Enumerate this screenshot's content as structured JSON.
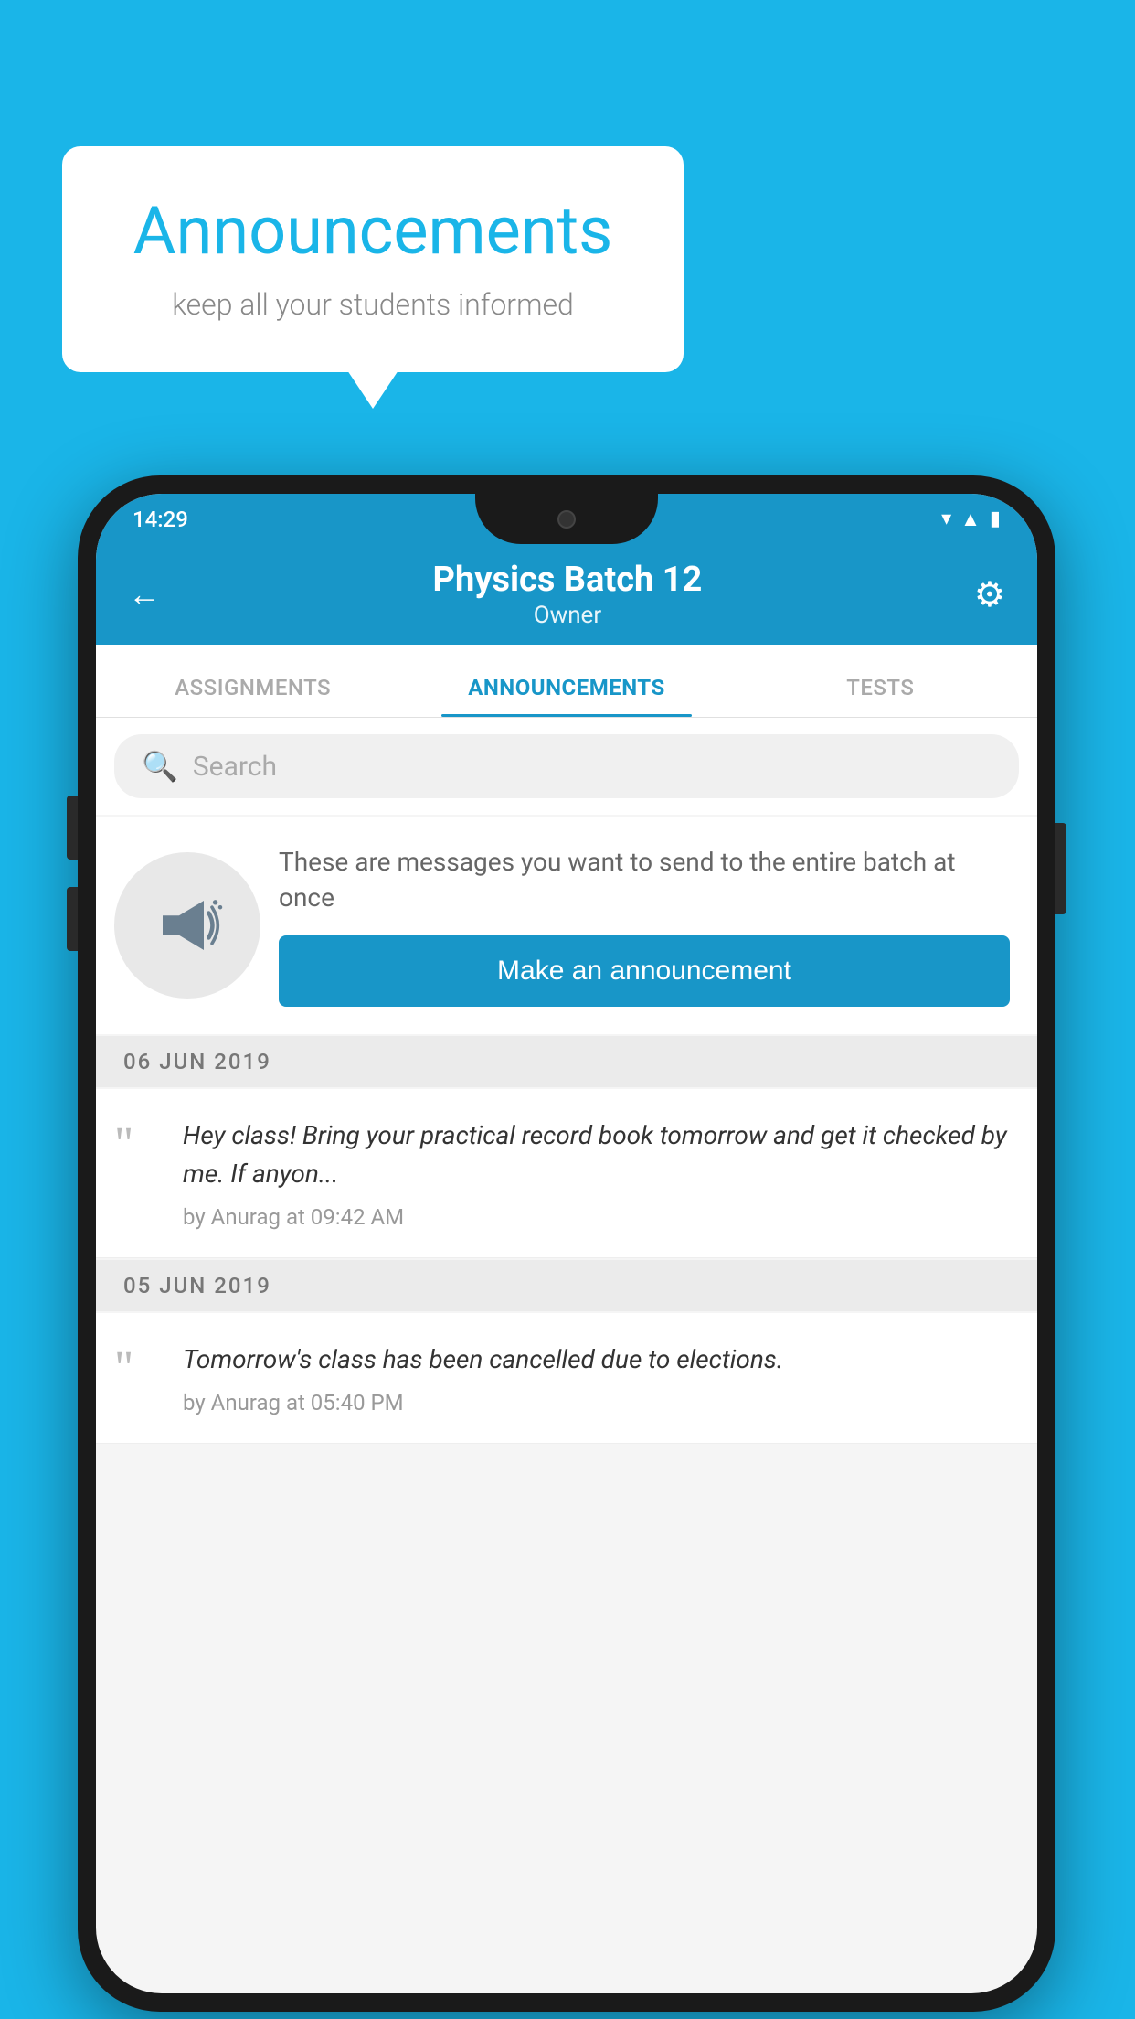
{
  "background_color": "#1ab5e8",
  "speech_bubble": {
    "title": "Announcements",
    "subtitle": "keep all your students informed"
  },
  "phone": {
    "status_bar": {
      "time": "14:29",
      "icons": [
        "wifi",
        "signal",
        "battery"
      ]
    },
    "app_bar": {
      "title": "Physics Batch 12",
      "subtitle": "Owner",
      "back_label": "←",
      "settings_label": "⚙"
    },
    "tabs": [
      {
        "label": "ASSIGNMENTS",
        "active": false
      },
      {
        "label": "ANNOUNCEMENTS",
        "active": true
      },
      {
        "label": "TESTS",
        "active": false
      }
    ],
    "search": {
      "placeholder": "Search"
    },
    "promo": {
      "description": "These are messages you want to send to the entire batch at once",
      "button_label": "Make an announcement"
    },
    "announcements": [
      {
        "date": "06  JUN  2019",
        "message": "Hey class! Bring your practical record book tomorrow and get it checked by me. If anyon...",
        "meta": "by Anurag at 09:42 AM"
      },
      {
        "date": "05  JUN  2019",
        "message": "Tomorrow's class has been cancelled due to elections.",
        "meta": "by Anurag at 05:40 PM"
      }
    ]
  }
}
